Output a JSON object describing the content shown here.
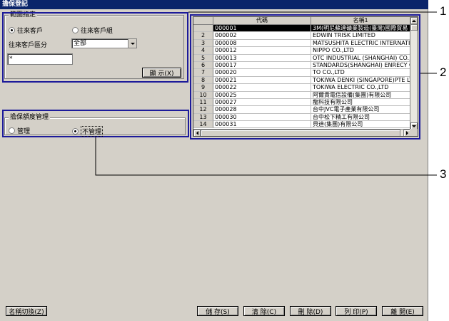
{
  "window": {
    "title": "擔保登記"
  },
  "range_group": {
    "title": "範圍指定",
    "radio_customer": "往來客戶",
    "radio_customer_group": "往來客戶組",
    "type_label": "往來客戶區分",
    "type_value": "全部",
    "filter_value": "*",
    "display_button": "顯 示(X)"
  },
  "guarantee_group": {
    "title": "擔保額度管理",
    "radio_manage": "管理",
    "radio_no_manage": "不管理"
  },
  "grid": {
    "headers": [
      "",
      "代碼",
      "名稱1"
    ],
    "rows": [
      {
        "num": "",
        "code": "000001",
        "name": "3M(明尼蘇達礦業製造(臺灣)國際貿易"
      },
      {
        "num": "2",
        "code": "000002",
        "name": "EDWIN TRISK LIMITED"
      },
      {
        "num": "3",
        "code": "000008",
        "name": "MATSUSHITA ELECTRIC INTERNATI"
      },
      {
        "num": "4",
        "code": "000012",
        "name": "NIPPO CO.,LTD"
      },
      {
        "num": "5",
        "code": "000013",
        "name": "OTC INDUSTRIAL (SHANGHAI) CO.,L"
      },
      {
        "num": "6",
        "code": "000017",
        "name": "STANDARDS(SHANGHAI) ENRECY CO"
      },
      {
        "num": "7",
        "code": "000020",
        "name": "TO CO.,LTD"
      },
      {
        "num": "8",
        "code": "000021",
        "name": "TOKIWA DENKI (SINGAPORE)PTE LT"
      },
      {
        "num": "9",
        "code": "000022",
        "name": "TOKIWA ELECTRIC CO.,LTD"
      },
      {
        "num": "10",
        "code": "000025",
        "name": "阿爾貴電信設備(集團)有限公司"
      },
      {
        "num": "11",
        "code": "000027",
        "name": "龍科技有限公司"
      },
      {
        "num": "12",
        "code": "000028",
        "name": "台中JVC電子產業有限公司"
      },
      {
        "num": "13",
        "code": "000030",
        "name": "台中松下精工有限公司"
      },
      {
        "num": "14",
        "code": "000031",
        "name": "貝迪(集團)有限公司"
      }
    ]
  },
  "footer": {
    "name_switch": "名稱切換(Z)",
    "save": "儲 存(S)",
    "clear": "清 除(C)",
    "delete": "刪 除(D)",
    "print": "列 印(P)",
    "close": "離 開(E)"
  },
  "callouts": [
    "1",
    "2",
    "3"
  ],
  "colors": {
    "highlight": "#1c1a9a",
    "titlebar": "#0a246a",
    "face": "#d4d0c8"
  }
}
